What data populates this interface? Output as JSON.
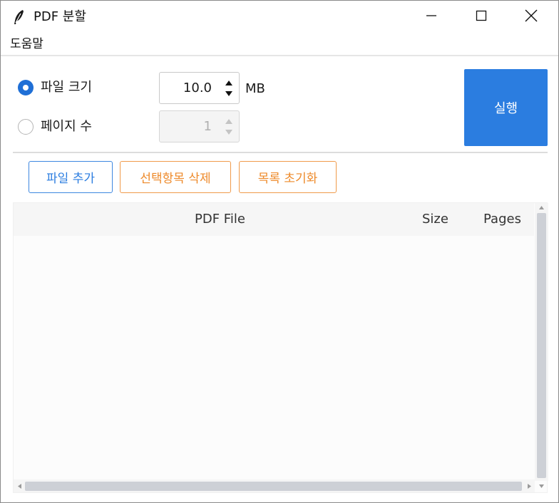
{
  "window": {
    "title": "PDF 분할",
    "app_icon": "feather-icon",
    "controls": {
      "minimize_icon": "minimize-icon",
      "maximize_icon": "maximize-icon",
      "close_icon": "close-icon"
    }
  },
  "menu": {
    "items": [
      {
        "label": "도움말"
      }
    ]
  },
  "options": {
    "file_size": {
      "label": "파일 크기",
      "selected": true,
      "value": "10.0",
      "unit": "MB"
    },
    "page_count": {
      "label": "페이지 수",
      "selected": false,
      "value": "1",
      "disabled": true
    }
  },
  "run_button": {
    "label": "실행",
    "color": "#2b7de0"
  },
  "actions": {
    "add_files": "파일 추가",
    "delete_selected": "선택항목 삭제",
    "clear_list": "목록 초기화"
  },
  "table": {
    "columns": [
      "PDF File",
      "Size",
      "Pages"
    ],
    "rows": []
  },
  "colors": {
    "accent": "#2b7de0",
    "warning": "#ee8a2a"
  }
}
